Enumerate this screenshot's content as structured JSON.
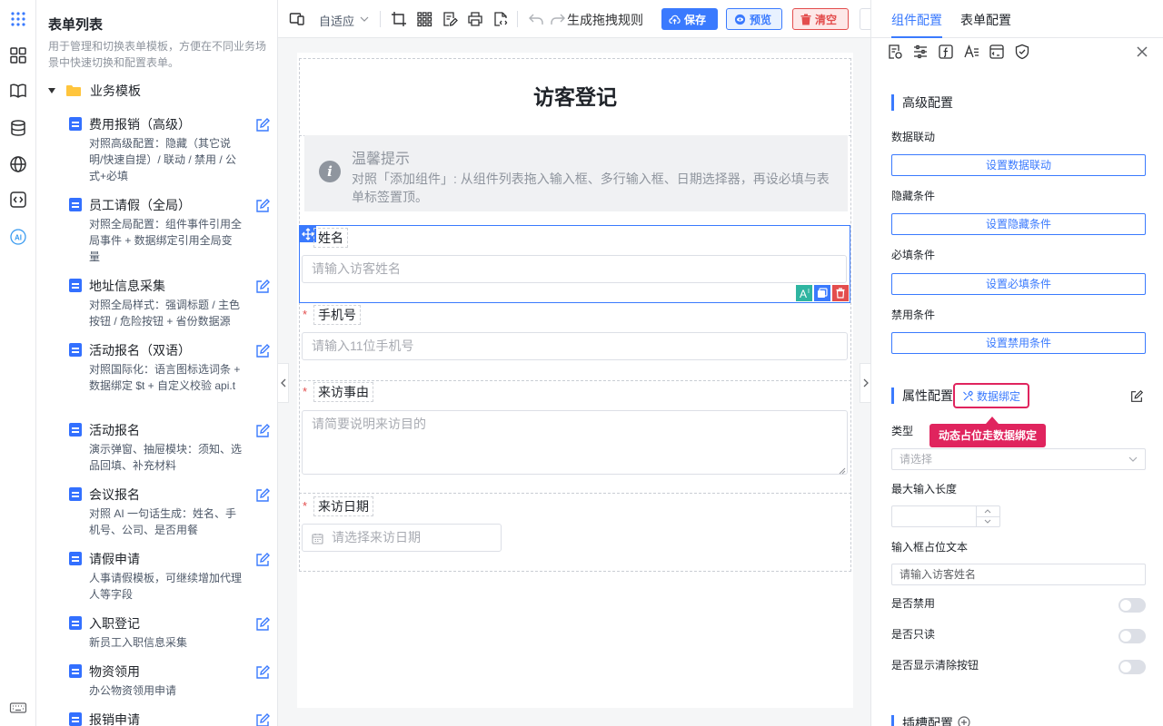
{
  "template_list": {
    "title": "表单列表",
    "description": "用于管理和切换表单模板，方便在不同业务场景中快速切换和配置表单。",
    "folder": "业务模板",
    "items": [
      {
        "name": "费用报销（高级）",
        "desc": "对照高级配置：隐藏（其它说明/快速自提）/ 联动 / 禁用 / 公式+必填"
      },
      {
        "name": "员工请假（全局）",
        "desc": "对照全局配置：组件事件引用全局事件 + 数据绑定引用全局变量"
      },
      {
        "name": "地址信息采集",
        "desc": "对照全局样式：强调标题 / 主色按钮 / 危险按钮 + 省份数据源"
      },
      {
        "name": "活动报名（双语）",
        "desc": "对照国际化：语言图标选词条 + 数据绑定 $t + 自定义校验 api.t"
      },
      {
        "name": "活动报名",
        "desc": "演示弹窗、抽屉模块：须知、选品回填、补充材料"
      },
      {
        "name": "会议报名",
        "desc": "对照 AI 一句话生成：姓名、手机号、公司、是否用餐"
      },
      {
        "name": "请假申请",
        "desc": "人事请假模板，可继续增加代理人等字段"
      },
      {
        "name": "入职登记",
        "desc": "新员工入职信息采集"
      },
      {
        "name": "物资领用",
        "desc": "办公物资领用申请"
      },
      {
        "name": "报销申请",
        "desc": ""
      }
    ]
  },
  "toolbar": {
    "adaptive_label": "自适应",
    "rules_label": "生成拖拽规则",
    "save_label": "保存",
    "preview_label": "预览",
    "clear_label": "清空"
  },
  "form": {
    "title": "访客登记",
    "alert_title": "温馨提示",
    "alert_desc": "对照「添加组件」: 从组件列表拖入输入框、多行输入框、日期选择器，再设必填与表单标签置顶。",
    "fields": [
      {
        "label": "姓名",
        "placeholder": "请输入访客姓名",
        "required": ""
      },
      {
        "label": "手机号",
        "placeholder": "请输入11位手机号",
        "required": "*"
      },
      {
        "label": "来访事由",
        "placeholder": "请简要说明来访目的",
        "required": "*"
      },
      {
        "label": "来访日期",
        "placeholder": "请选择来访日期",
        "required": "*"
      }
    ]
  },
  "right_panel": {
    "tabs": [
      "组件配置",
      "表单配置"
    ],
    "advanced_title": "高级配置",
    "data_linkage_label": "数据联动",
    "data_linkage_btn": "设置数据联动",
    "hidden_label": "隐藏条件",
    "hidden_btn": "设置隐藏条件",
    "required_label": "必填条件",
    "required_btn": "设置必填条件",
    "disabled_label": "禁用条件",
    "disabled_btn": "设置禁用条件",
    "attr_title": "属性配置",
    "bind_btn": "数据绑定",
    "tooltip": "动态占位走数据绑定",
    "type_label": "类型",
    "type_placeholder": "请选择",
    "maxlen_label": "最大输入长度",
    "placeholder_label": "输入框占位文本",
    "placeholder_value": "请输入访客姓名",
    "is_disabled": "是否禁用",
    "is_readonly": "是否只读",
    "show_clear": "是否显示清除按钮",
    "slot_title": "插槽配置"
  },
  "colors": {
    "primary": "#3a7afe",
    "danger": "#e34d4d",
    "highlight": "#e0245e"
  }
}
